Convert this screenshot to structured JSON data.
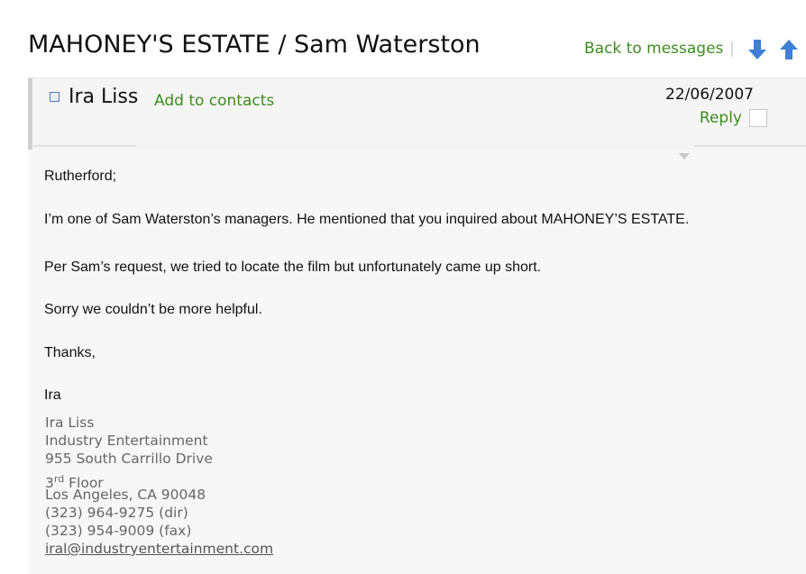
{
  "header": {
    "title": "MAHONEY'S ESTATE / Sam Waterston",
    "back_label": "Back to messages",
    "separator": "|",
    "nav_down_icon": "arrow-down-icon",
    "nav_up_icon": "arrow-up-icon"
  },
  "message": {
    "sender": "Ira Liss",
    "add_contacts_label": "Add to contacts",
    "date": "22/06/2007",
    "reply_label": "Reply"
  },
  "body": {
    "greeting": "Rutherford;",
    "para1": "I’m one of Sam Waterston’s managers. He mentioned that you inquired about MAHONEY’S ESTATE.",
    "para2": "Per Sam’s request, we tried to locate the film but unfortunately came up short.",
    "para3": "Sorry we couldn’t be more helpful.",
    "thanks": "Thanks,",
    "signoff": "Ira"
  },
  "signature": {
    "name": "Ira Liss",
    "company": "Industry Entertainment",
    "street": "955 South Carrillo Drive",
    "floor_num": "3",
    "floor_sup": "rd",
    "floor_word": " Floor",
    "city": "Los Angeles, CA  90048",
    "phone_dir": "(323) 964-9275 (dir)",
    "phone_fax": "(323) 954-9009 (fax)",
    "email": "iral@industryentertainment.com"
  },
  "colors": {
    "link_green": "#3d8c1f",
    "arrow_blue": "#3f7fd6",
    "panel_bg": "#f7f7f7"
  }
}
